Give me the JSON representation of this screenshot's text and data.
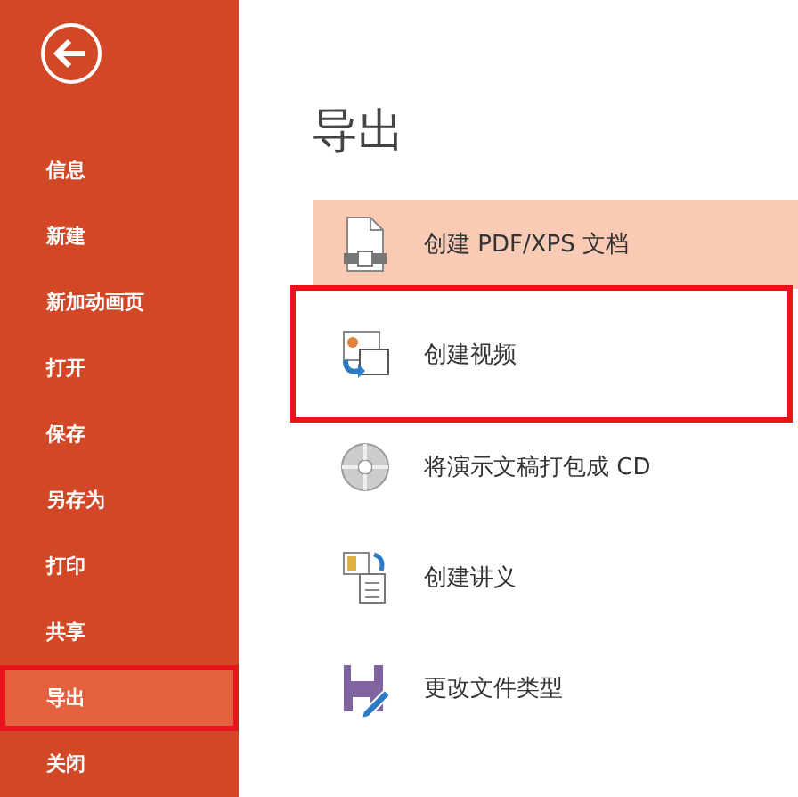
{
  "sidebar": {
    "items": [
      {
        "label": "信息",
        "selected": false,
        "highlighted": false
      },
      {
        "label": "新建",
        "selected": false,
        "highlighted": false
      },
      {
        "label": "新加动画页",
        "selected": false,
        "highlighted": false
      },
      {
        "label": "打开",
        "selected": false,
        "highlighted": false
      },
      {
        "label": "保存",
        "selected": false,
        "highlighted": false
      },
      {
        "label": "另存为",
        "selected": false,
        "highlighted": false
      },
      {
        "label": "打印",
        "selected": false,
        "highlighted": false
      },
      {
        "label": "共享",
        "selected": false,
        "highlighted": false
      },
      {
        "label": "导出",
        "selected": true,
        "highlighted": true
      },
      {
        "label": "关闭",
        "selected": false,
        "highlighted": false
      }
    ]
  },
  "main": {
    "title": "导出",
    "options": [
      {
        "kind": "pdf",
        "label": "创建 PDF/XPS 文档",
        "selected": true,
        "highlighted": false
      },
      {
        "kind": "video",
        "label": "创建视频",
        "selected": false,
        "highlighted": true
      },
      {
        "kind": "cd",
        "label": "将演示文稿打包成 CD",
        "selected": false,
        "highlighted": false
      },
      {
        "kind": "handout",
        "label": "创建讲义",
        "selected": false,
        "highlighted": false
      },
      {
        "kind": "filetype",
        "label": "更改文件类型",
        "selected": false,
        "highlighted": false
      }
    ]
  }
}
